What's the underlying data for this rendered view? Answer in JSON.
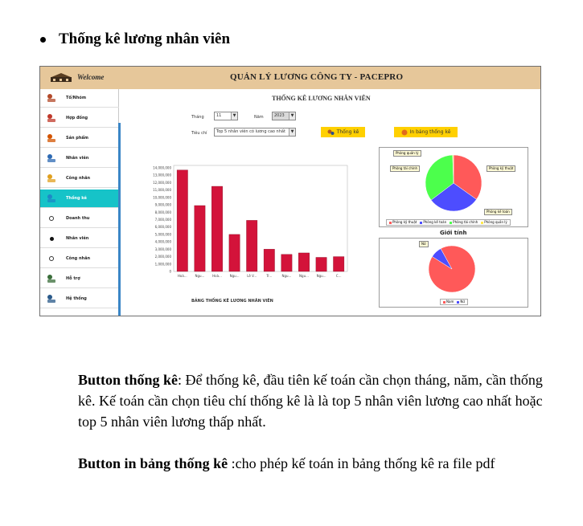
{
  "heading": "Thống kê lương nhân viên",
  "screenshot": {
    "welcome": "Welcome",
    "app_title": "QUẢN LÝ LƯƠNG CÔNG TY - PACEPRO",
    "sidebar": [
      {
        "label": "Tổ/Nhóm",
        "icon": "group-icon"
      },
      {
        "label": "Hợp đồng",
        "icon": "contract-icon"
      },
      {
        "label": "Sản phẩm",
        "icon": "product-icon"
      },
      {
        "label": "Nhân viên",
        "icon": "employee-icon"
      },
      {
        "label": "Công nhân",
        "icon": "worker-icon"
      },
      {
        "label": "Thống kê",
        "icon": "statistics-icon",
        "active": true
      },
      {
        "label": "Doanh thu",
        "icon": "radio-empty-icon"
      },
      {
        "label": "Nhân viên",
        "icon": "radio-filled-icon"
      },
      {
        "label": "Công nhân",
        "icon": "radio-empty-icon"
      },
      {
        "label": "Hỗ trợ",
        "icon": "support-icon"
      },
      {
        "label": "Hệ thống",
        "icon": "system-icon"
      }
    ],
    "main_title": "THỐNG KÊ LƯƠNG NHÂN VIÊN",
    "month_label": "Tháng",
    "month_value": "11",
    "year_label": "Năm",
    "year_value": "2023",
    "criteria_label": "Tiêu chí",
    "criteria_value": "Top 5 nhân viên có lương cao nhất",
    "btn_stats": "Thống kê",
    "btn_print": "In bảng thống kê",
    "pie_callouts": [
      "Phòng quản lý",
      "Phòng tài chính",
      "Phòng kỹ thuật",
      "Phòng kế toán"
    ],
    "pie_legend": [
      "Phòng kỹ thuật",
      "Phòng kế toán",
      "Phòng tài chính",
      "Phòng quản lý"
    ],
    "gender_title": "Giới tính",
    "gender_callout": "Nữ",
    "gender_legend": [
      "Nam",
      "Nữ"
    ]
  },
  "chart_data": [
    {
      "type": "bar",
      "title": "BẢNG THỐNG KÊ LƯƠNG NHÂN VIÊN",
      "categories": [
        "Hoà...",
        "Ngu...",
        "Hoà...",
        "Ngu...",
        "Lê V...",
        "Tr...",
        "Ngu...",
        "Ngu...",
        "Ngu...",
        "C..."
      ],
      "values": [
        13700000,
        8900000,
        11500000,
        5000000,
        6900000,
        3000000,
        2300000,
        2500000,
        1900000,
        2000000
      ],
      "yticks": [
        "14,000,000",
        "13,000,000",
        "12,000,000",
        "11,000,000",
        "10,000,000",
        "9,000,000",
        "8,000,000",
        "7,000,000",
        "6,000,000",
        "5,000,000",
        "4,000,000",
        "3,000,000",
        "2,000,000",
        "1,000,000",
        "0"
      ],
      "ylim": [
        0,
        14000000
      ],
      "color": "#d3133a"
    },
    {
      "type": "pie",
      "labels": [
        "Phòng kỹ thuật",
        "Phòng kế toán",
        "Phòng tài chính",
        "Phòng quản lý"
      ],
      "values": [
        35,
        30,
        35,
        0.5
      ],
      "colors": [
        "#ff5959",
        "#4d4dff",
        "#4cff4c",
        "#ffe84d"
      ]
    },
    {
      "type": "pie",
      "title": "Giới tính",
      "labels": [
        "Nam",
        "Nữ"
      ],
      "values": [
        92,
        8
      ],
      "colors": [
        "#ff5959",
        "#4d4dff"
      ]
    }
  ],
  "paragraph1": {
    "bold": "Button thống kê",
    "text": ": Để thống kê, đầu tiên kế toán cần chọn tháng, năm, cần thống kê. Kế toán cần chọn tiêu chí thống kê là là top 5 nhân viên lương cao nhất hoặc top 5 nhân viên lương thấp nhất."
  },
  "paragraph2": {
    "bold": "Button in bảng thống kê",
    "text": " :cho phép kế toán in bảng thống kê ra file pdf"
  }
}
